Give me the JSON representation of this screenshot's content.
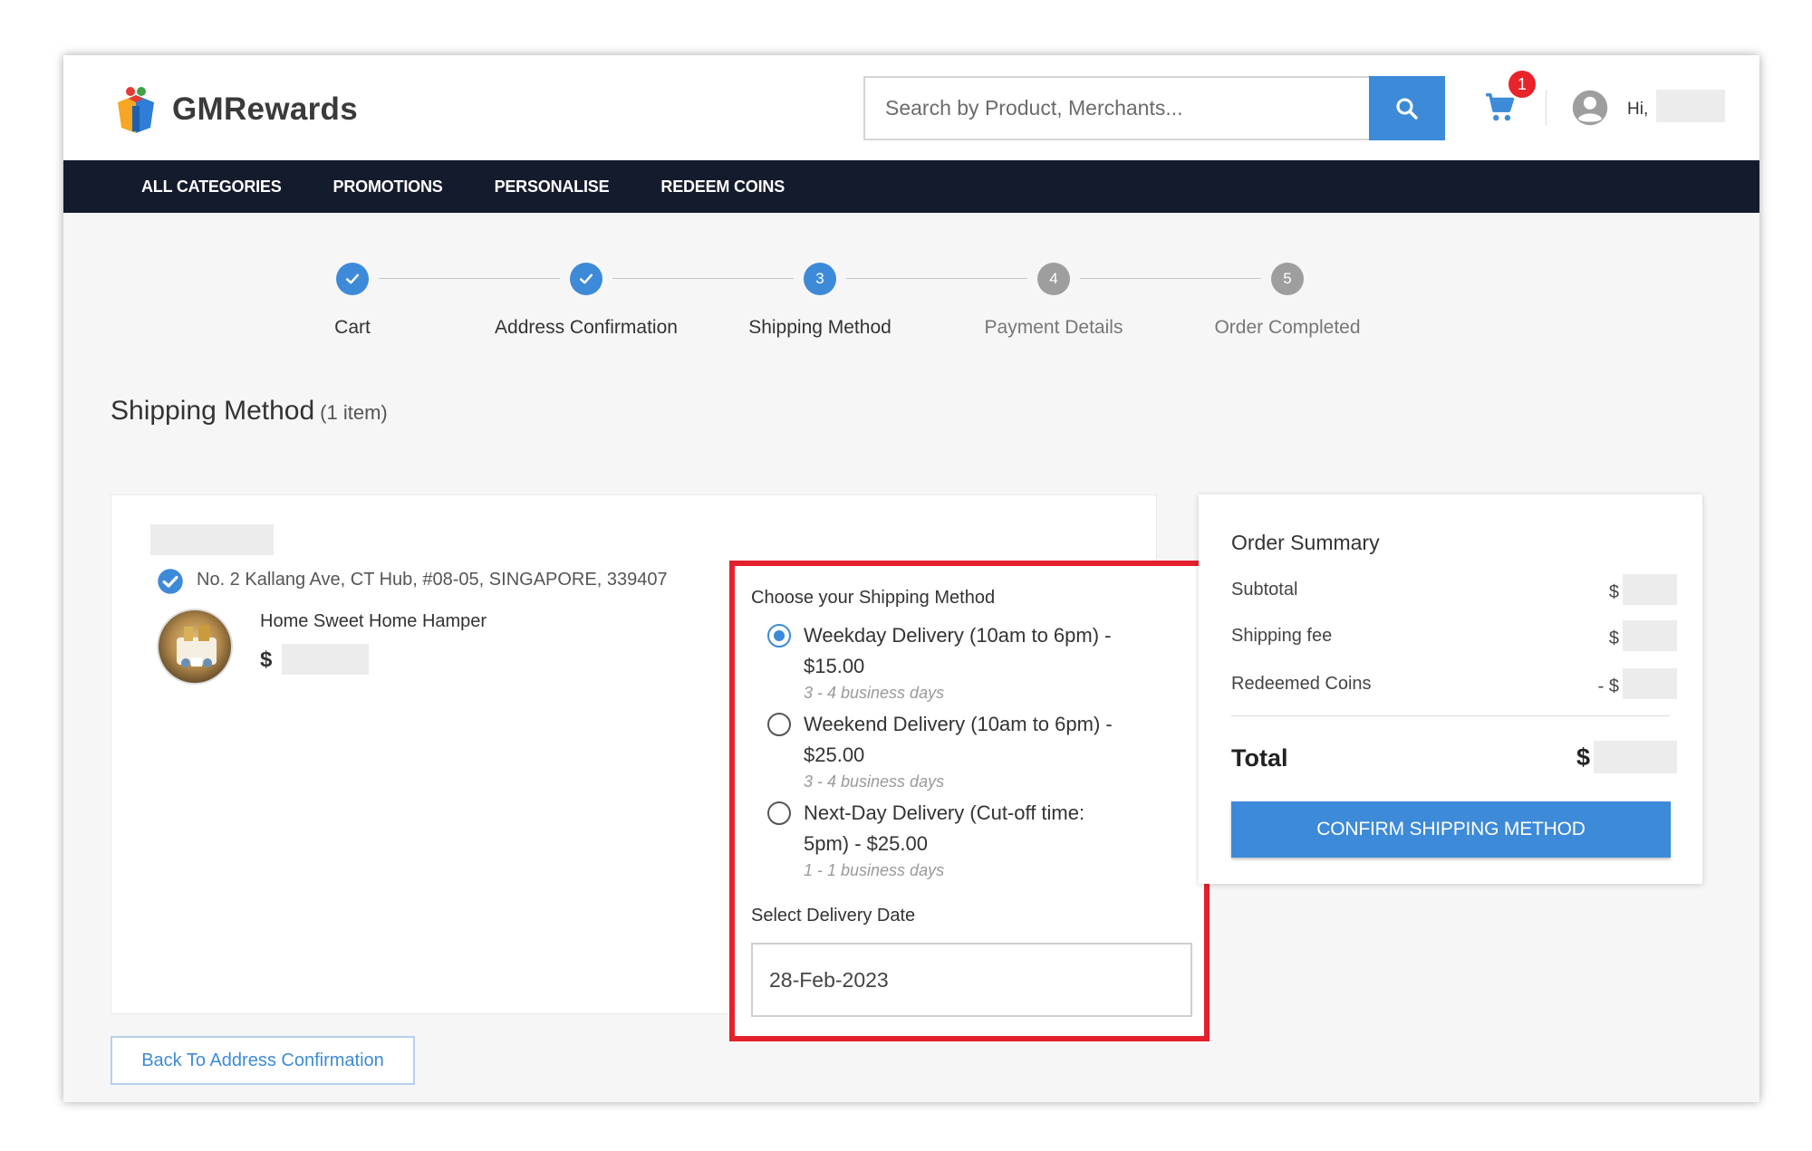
{
  "header": {
    "brand": "GMRewards",
    "search_placeholder": "Search by Product, Merchants...",
    "cart_count": "1",
    "greeting": "Hi,"
  },
  "nav": {
    "items": [
      "ALL CATEGORIES",
      "PROMOTIONS",
      "PERSONALISE",
      "REDEEM COINS"
    ]
  },
  "stepper": {
    "steps": [
      {
        "num": "",
        "label": "Cart",
        "state": "done"
      },
      {
        "num": "",
        "label": "Address Confirmation",
        "state": "done"
      },
      {
        "num": "3",
        "label": "Shipping Method",
        "state": "active"
      },
      {
        "num": "4",
        "label": "Payment Details",
        "state": "pending"
      },
      {
        "num": "5",
        "label": "Order Completed",
        "state": "pending"
      }
    ]
  },
  "page": {
    "title": "Shipping Method",
    "subtitle": "(1 item)"
  },
  "item": {
    "address": "No. 2 Kallang Ave, CT Hub, #08-05, SINGAPORE, 339407",
    "product_name": "Home Sweet Home Hamper",
    "currency": "$"
  },
  "shipping": {
    "heading": "Choose your Shipping Method",
    "options": [
      {
        "line1": "Weekday Delivery (10am to 6pm) -",
        "line2": "$15.00",
        "days": "3 - 4 business days",
        "selected": true
      },
      {
        "line1": "Weekend Delivery (10am to 6pm) -",
        "line2": "$25.00",
        "days": "3 - 4 business days",
        "selected": false
      },
      {
        "line1": "Next-Day Delivery (Cut-off time:",
        "line2": "5pm) - $25.00",
        "days": "1 - 1 business days",
        "selected": false
      }
    ],
    "date_label": "Select Delivery Date",
    "date_value": "28-Feb-2023"
  },
  "summary": {
    "title": "Order Summary",
    "subtotal_label": "Subtotal",
    "subtotal_prefix": "$",
    "shipping_label": "Shipping fee",
    "shipping_prefix": "$",
    "coins_label": "Redeemed Coins",
    "coins_prefix": "- $",
    "total_label": "Total",
    "total_prefix": "$",
    "confirm_label": "CONFIRM SHIPPING METHOD"
  },
  "back_label": "Back To Address Confirmation",
  "colors": {
    "accent": "#3d8ad9",
    "nav_bg": "#131b2c",
    "highlight": "#e4202d",
    "badge": "#e8232a"
  }
}
